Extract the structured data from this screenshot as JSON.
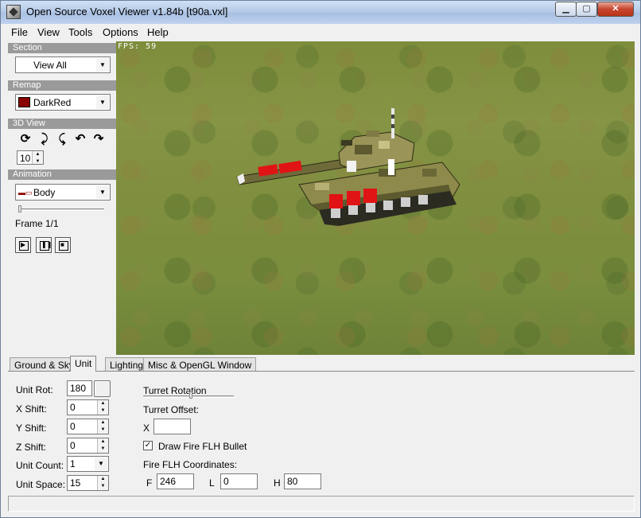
{
  "window": {
    "title": "Open Source Voxel Viewer v1.84b [t90a.vxl]"
  },
  "menu": [
    "File",
    "View",
    "Tools",
    "Options",
    "Help"
  ],
  "left_panel": {
    "section": {
      "header": "Section",
      "value": "View All"
    },
    "remap": {
      "header": "Remap",
      "value": "DarkRed",
      "color": "#8b0000"
    },
    "view3d": {
      "header": "3D View",
      "step_value": "10"
    },
    "animation": {
      "header": "Animation",
      "value": "Body",
      "frame_label": "Frame 1/1",
      "progress": 0
    }
  },
  "viewport": {
    "fps_label": "FPS: 59"
  },
  "tabs": [
    "Ground & Sky",
    "Unit",
    "Lighting",
    "Misc & OpenGL Window"
  ],
  "active_tab": "Unit",
  "unit_tab": {
    "unit_rot": {
      "label": "Unit Rot:",
      "value": "180"
    },
    "x_shift": {
      "label": "X Shift:",
      "value": "0"
    },
    "y_shift": {
      "label": "Y Shift:",
      "value": "0"
    },
    "z_shift": {
      "label": "Z Shift:",
      "value": "0"
    },
    "unit_count": {
      "label": "Unit Count:",
      "value": "1"
    },
    "unit_space": {
      "label": "Unit Space:",
      "value": "15"
    },
    "turret_rotation_label": "Turret Rotation",
    "turret_offset_label": "Turret Offset:",
    "turret_offset_x_label": "X",
    "turret_offset_x_value": "",
    "draw_fire_flh_label": "Draw Fire FLH Bullet",
    "draw_fire_flh_checked": true,
    "fire_flh_label": "Fire FLH Coordinates:",
    "flh": {
      "f_label": "F",
      "f_value": "246",
      "l_label": "L",
      "l_value": "0",
      "h_label": "H",
      "h_value": "80"
    }
  }
}
